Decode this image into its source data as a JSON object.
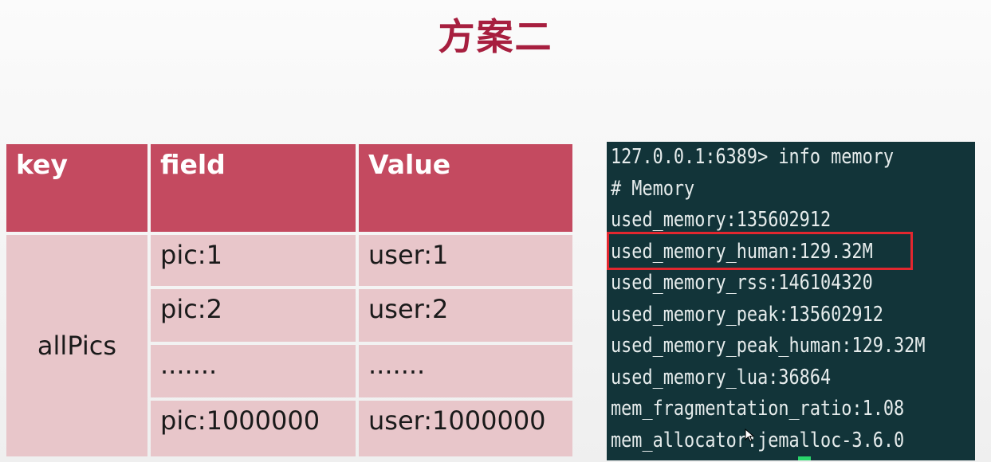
{
  "slide": {
    "title": "方案二"
  },
  "table": {
    "headers": [
      "key",
      "field",
      "Value"
    ],
    "key": "allPics",
    "rows": [
      {
        "field": "pic:1",
        "value": "user:1"
      },
      {
        "field": "pic:2",
        "value": "user:2"
      },
      {
        "field": ".......",
        "value": "......."
      },
      {
        "field": "pic:1000000",
        "value": "user:1000000"
      }
    ],
    "colors": {
      "header_bg": "#c44a60",
      "body_bg": "#e8c6ca",
      "title": "#a71f3f"
    }
  },
  "terminal": {
    "lines": [
      "127.0.0.1:6389> info memory",
      "# Memory",
      "used_memory:135602912",
      "used_memory_human:129.32M",
      "used_memory_rss:146104320",
      "used_memory_peak:135602912",
      "used_memory_peak_human:129.32M",
      "used_memory_lua:36864",
      "mem_fragmentation_ratio:1.08",
      "mem_allocator:jemalloc-3.6.0"
    ],
    "highlighted_line": "used_memory_human:129.32M",
    "colors": {
      "background": "#123439",
      "text": "#e6ecec",
      "highlight": "#e2272f",
      "cursor": "#29d66b"
    }
  }
}
